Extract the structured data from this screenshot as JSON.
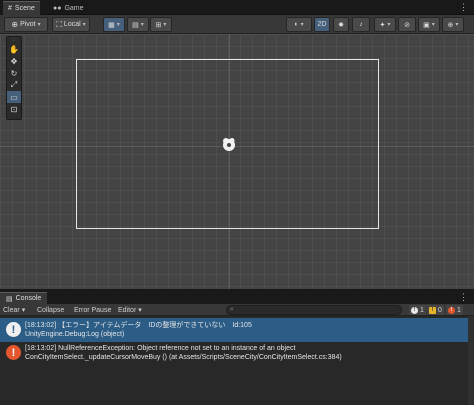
{
  "tabs": [
    {
      "label": "Scene",
      "icon": "grid-icon"
    },
    {
      "label": "Game",
      "icon": "gamepad-icon"
    }
  ],
  "toolbar": {
    "pivot_label": "Pivot",
    "local_label": "Local",
    "mode_2d_label": "2D"
  },
  "console": {
    "tab_label": "Console",
    "clear_label": "Clear",
    "collapse_label": "Collapse",
    "error_pause_label": "Error Pause",
    "editor_label": "Editor",
    "search_placeholder": "",
    "counts": {
      "info": "1",
      "warn": "0",
      "error": "1"
    },
    "entries": [
      {
        "type": "info",
        "line1": "[18:13:02] 【エラー】アイテムデータ　IDの整理ができていない　Id:105",
        "line2": "UnityEngine.Debug:Log (object)"
      },
      {
        "type": "error",
        "line1": "[18:13:02] NullReferenceException: Object reference not set to an instance of an object",
        "line2": "ConCityItemSelect._updateCursorMoveBuy () (at Assets/Scripts/SceneCity/ConCityItemSelect.cs:384)"
      }
    ]
  },
  "colors": {
    "selection": "#2c5d87",
    "error": "#e4572e",
    "viewport_bg": "#444444"
  }
}
